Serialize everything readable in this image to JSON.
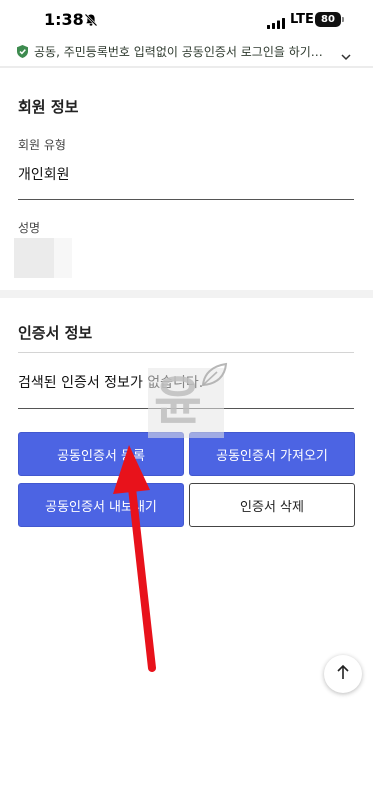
{
  "status_bar": {
    "time": "1:38",
    "network": "LTE",
    "battery": "80"
  },
  "notice": {
    "text": "공동, 주민등록번호 입력없이 공동인증서 로그인을 하기…"
  },
  "member_info": {
    "title": "회원 정보",
    "type_label": "회원 유형",
    "type_value": "개인회원",
    "name_label": "성명"
  },
  "cert_info": {
    "title": "인증서 정보",
    "empty_message": "검색된 인증서 정보가 없습니다."
  },
  "buttons": {
    "register": "공동인증서 등록",
    "import": "공동인증서 가져오기",
    "export": "공동인증서 내보내기",
    "delete": "인증서 삭제"
  },
  "watermark": {
    "glyph": "윤"
  },
  "colors": {
    "primary": "#4c64e3",
    "annotation_arrow": "#e8121b"
  },
  "icons": {
    "scroll_top": "arrow-up-icon",
    "notice": "shield-icon",
    "expand": "chevron-down-icon"
  }
}
